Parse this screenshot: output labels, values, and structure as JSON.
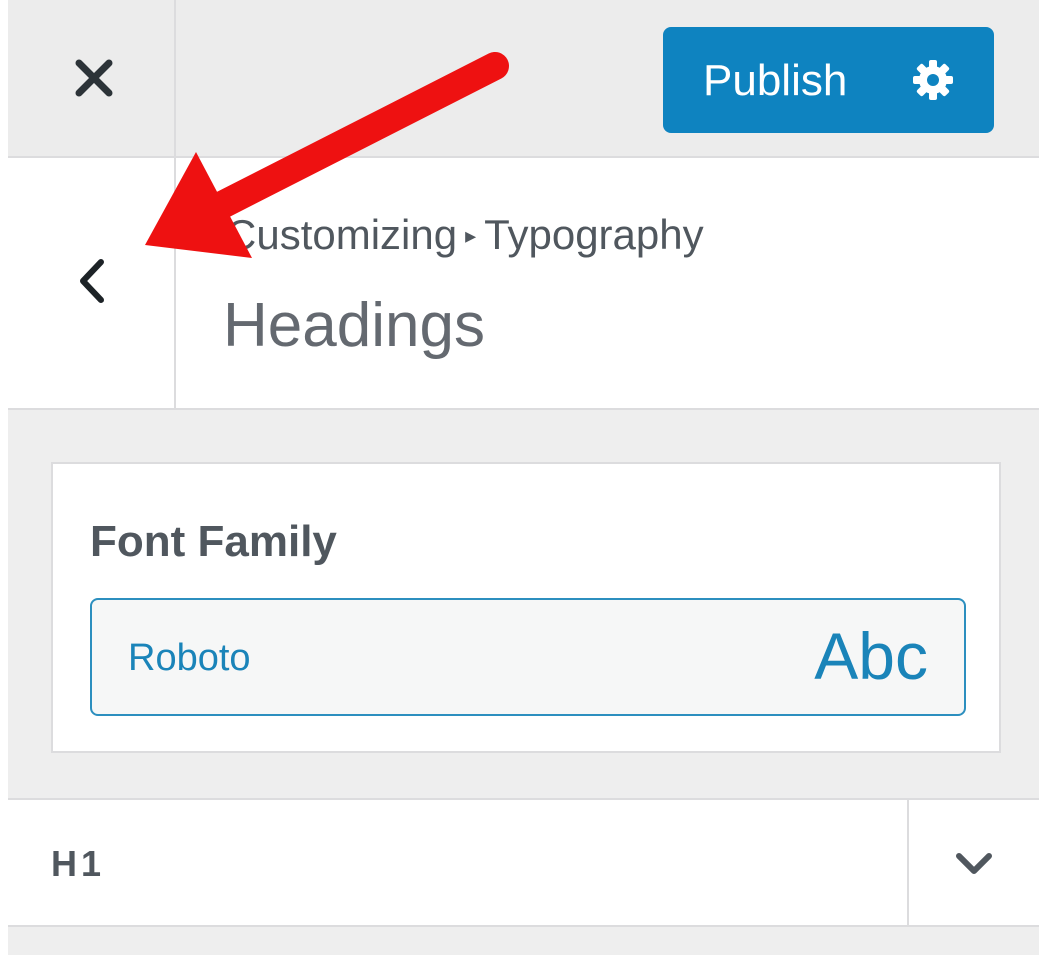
{
  "topbar": {
    "close_icon": "close-icon",
    "publish_label": "Publish",
    "settings_icon": "gear-icon"
  },
  "header": {
    "back_icon": "chevron-left-icon",
    "breadcrumb_parent": "Customizing",
    "breadcrumb_separator": "▸",
    "breadcrumb_current": "Typography",
    "title": "Headings"
  },
  "font_family": {
    "label": "Font Family",
    "value": "Roboto",
    "preview": "Abc"
  },
  "accordion": {
    "label": "H1",
    "toggle_icon": "chevron-down-icon"
  },
  "colors": {
    "accent": "#0e83c0",
    "annotation_arrow": "#ee1111"
  }
}
